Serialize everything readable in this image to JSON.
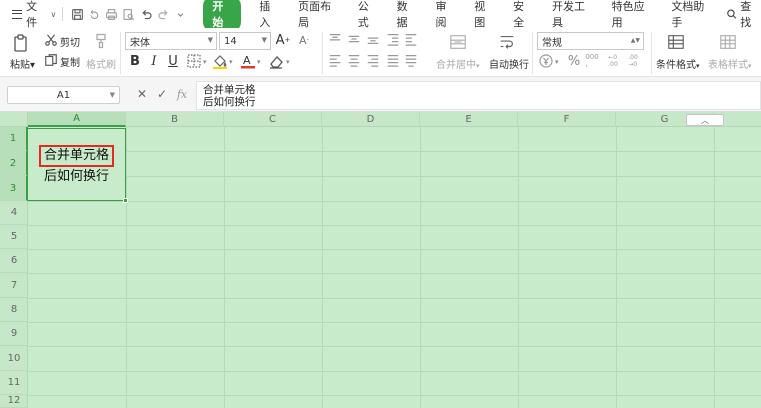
{
  "menu": {
    "file_label": "文件",
    "tabs": [
      {
        "label": "开始",
        "active": true
      },
      {
        "label": "插入",
        "active": false
      },
      {
        "label": "页面布局",
        "active": false
      },
      {
        "label": "公式",
        "active": false
      },
      {
        "label": "数据",
        "active": false
      },
      {
        "label": "审阅",
        "active": false
      },
      {
        "label": "视图",
        "active": false
      },
      {
        "label": "安全",
        "active": false
      },
      {
        "label": "开发工具",
        "active": false
      },
      {
        "label": "特色应用",
        "active": false
      },
      {
        "label": "文档助手",
        "active": false
      }
    ],
    "search_label": "查找"
  },
  "ribbon": {
    "paste_label": "粘贴",
    "cut_label": "剪切",
    "copy_label": "复制",
    "format_painter_label": "格式刷",
    "font_name": "宋体",
    "font_size": "14",
    "bold": "B",
    "italic": "I",
    "underline": "U",
    "merge_center_label": "合并居中",
    "wrap_text_label": "自动换行",
    "number_format": "常规",
    "conditional_format_label": "条件格式",
    "table_style_label": "表格样式"
  },
  "formula_bar": {
    "name_box": "A1",
    "fx": "fx",
    "content_line1": "合并单元格",
    "content_line2": "后如何换行"
  },
  "sheet": {
    "columns": [
      "A",
      "B",
      "C",
      "D",
      "E",
      "F",
      "G"
    ],
    "rows": [
      "1",
      "2",
      "3",
      "4",
      "5",
      "6",
      "7",
      "8",
      "9",
      "10",
      "11",
      "12"
    ],
    "selected_column": "A",
    "merged_cell_line1": "合并单元格",
    "merged_cell_line2": "后如何换行"
  },
  "colors": {
    "accent": "#38a548",
    "sheet_bg": "#c8eccb",
    "highlight": "#e12a22"
  }
}
